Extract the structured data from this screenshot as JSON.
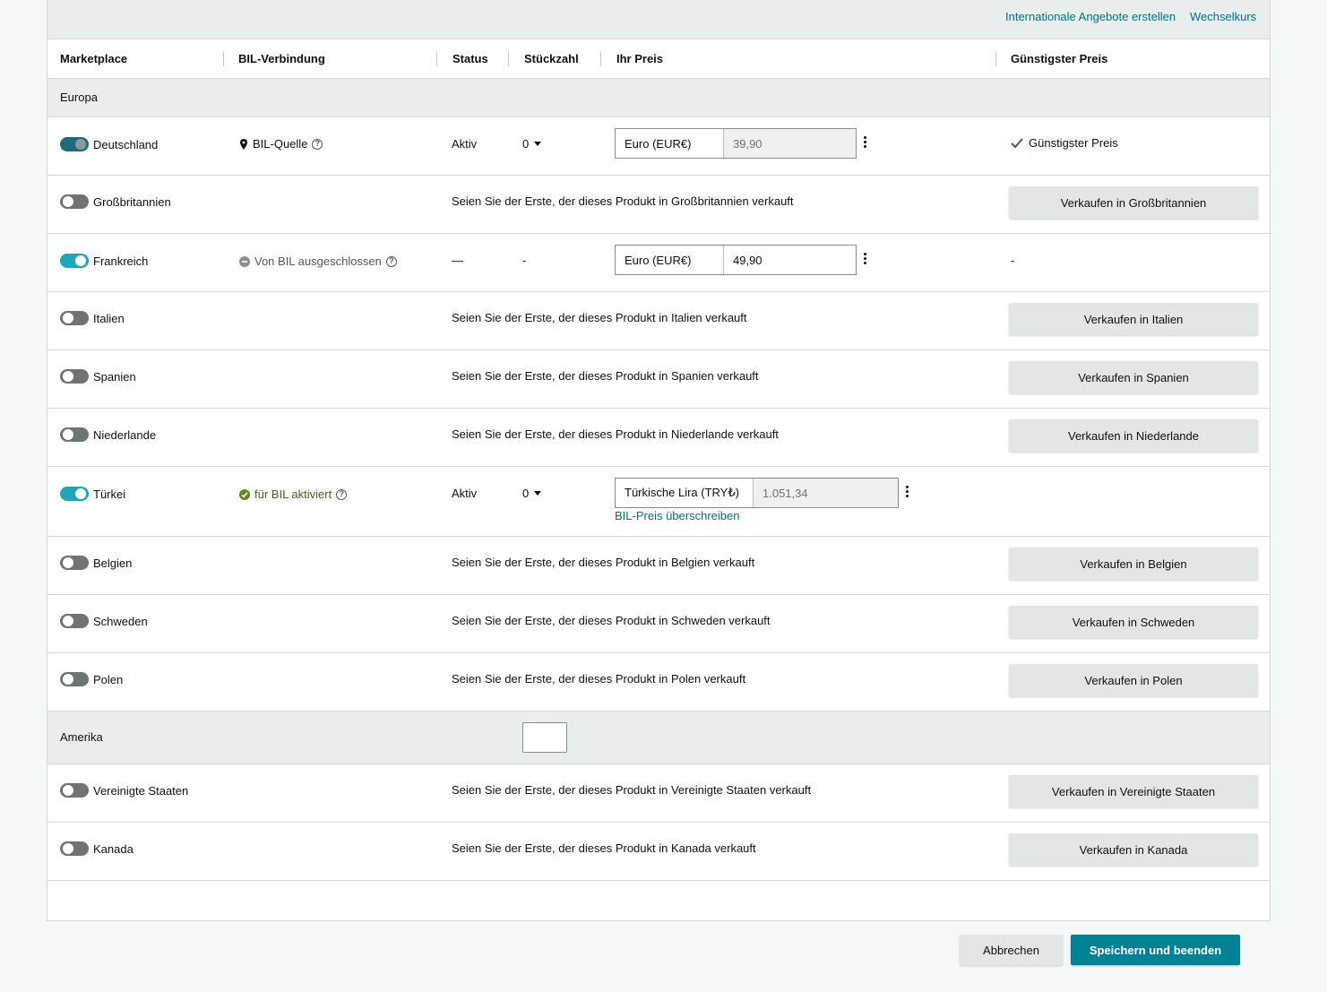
{
  "toplinks": {
    "international": "Internationale Angebote erstellen",
    "exchange": "Wechselkurs"
  },
  "columns": {
    "marketplace": "Marketplace",
    "bil": "BIL-Verbindung",
    "status": "Status",
    "qty": "Stückzahl",
    "price": "Ihr Preis",
    "lowest": "Günstigster Preis"
  },
  "groups": {
    "europe": "Europa",
    "america": "Amerika"
  },
  "rows": {
    "deutschland": {
      "label": "Deutschland",
      "enabled": true,
      "bil": "BIL-Quelle",
      "status": "Aktiv",
      "qty": "0",
      "currency": "Euro (EUR€)",
      "price": "39,90",
      "lowest": "Günstigster Preis"
    },
    "gb": {
      "label": "Großbritannien",
      "enabled": false,
      "message": "Seien Sie der Erste, der dieses Produkt in Großbritannien verkauft",
      "button": "Verkaufen in Großbritannien"
    },
    "frankreich": {
      "label": "Frankreich",
      "enabled": true,
      "bil": "Von BIL ausgeschlossen",
      "status": "—",
      "qty": "-",
      "currency": "Euro (EUR€)",
      "price": "49,90",
      "lowest": "-"
    },
    "italien": {
      "label": "Italien",
      "enabled": false,
      "message": "Seien Sie der Erste, der dieses Produkt in Italien verkauft",
      "button": "Verkaufen in Italien"
    },
    "spanien": {
      "label": "Spanien",
      "enabled": false,
      "message": "Seien Sie der Erste, der dieses Produkt in Spanien verkauft",
      "button": "Verkaufen in Spanien"
    },
    "niederlande": {
      "label": "Niederlande",
      "enabled": false,
      "message": "Seien Sie der Erste, der dieses Produkt in Niederlande verkauft",
      "button": "Verkaufen in Niederlande"
    },
    "tuerkei": {
      "label": "Türkei",
      "enabled": true,
      "bil": "für BIL aktiviert",
      "status": "Aktiv",
      "qty": "0",
      "currency": "Türkische Lira (TRY₺)",
      "price": "1.051,34",
      "override": "BIL-Preis überschreiben"
    },
    "belgien": {
      "label": "Belgien",
      "enabled": false,
      "message": "Seien Sie der Erste, der dieses Produkt in Belgien verkauft",
      "button": "Verkaufen in Belgien"
    },
    "schweden": {
      "label": "Schweden",
      "enabled": false,
      "message": "Seien Sie der Erste, der dieses Produkt in Schweden verkauft",
      "button": "Verkaufen in Schweden"
    },
    "polen": {
      "label": "Polen",
      "enabled": false,
      "message": "Seien Sie der Erste, der dieses Produkt in Polen verkauft",
      "button": "Verkaufen in Polen"
    },
    "usa": {
      "label": "Vereinigte Staaten",
      "enabled": false,
      "message": "Seien Sie der Erste, der dieses Produkt in Vereinigte Staaten verkauft",
      "button": "Verkaufen in Vereinigte Staaten"
    },
    "kanada": {
      "label": "Kanada",
      "enabled": false,
      "message": "Seien Sie der Erste, der dieses Produkt in Kanada verkauft",
      "button": "Verkaufen in Kanada"
    }
  },
  "footer": {
    "cancel": "Abbrechen",
    "save": "Speichern und beenden"
  },
  "colors": {
    "accent": "#008296",
    "link": "#007185",
    "toggle_on": "#1fa6b8",
    "group_bg": "#e8eded"
  }
}
